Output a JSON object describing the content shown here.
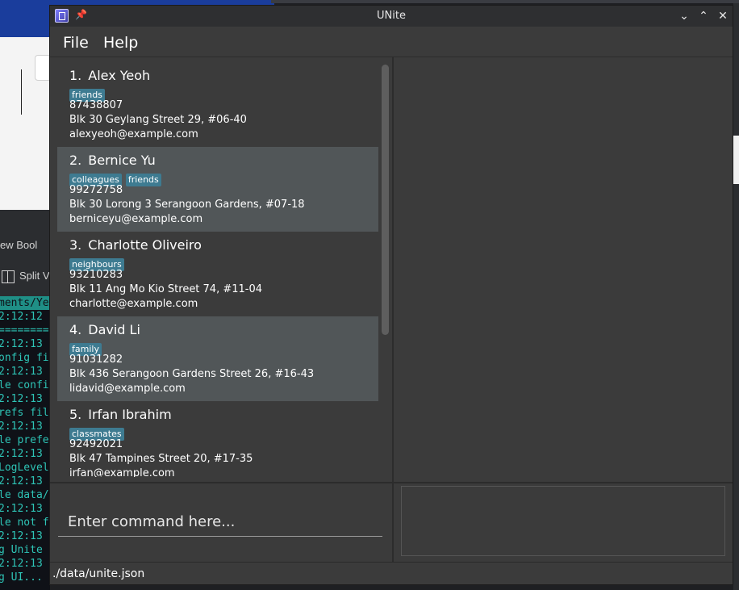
{
  "background": {
    "menu_fragment": "ew   Bool",
    "split_fragment": "Split V",
    "console_lines": [
      "ments/Ye",
      "2:12:12",
      "========",
      "2:12:13",
      "onfig fi",
      "2:12:13",
      "le confi",
      "2:12:13",
      "refs fil",
      "2:12:13",
      "le prefe",
      "2:12:13",
      "LogLevel",
      "2:12:13",
      "le data/",
      "2:12:13",
      "le not f",
      "2:12:13",
      "g Unite",
      "2:12:13",
      "g UI..."
    ]
  },
  "window": {
    "title": "UNite",
    "controls": {
      "minimize": "⌄",
      "maximize": "⌃",
      "close": "✕"
    }
  },
  "menu": {
    "file": "File",
    "help": "Help"
  },
  "persons": [
    {
      "index": "1.",
      "name": "Alex Yeoh",
      "tags": [
        "friends"
      ],
      "phone": "87438807",
      "address": "Blk 30 Geylang Street 29, #06-40",
      "email": "alexyeoh@example.com"
    },
    {
      "index": "2.",
      "name": "Bernice Yu",
      "tags": [
        "colleagues",
        "friends"
      ],
      "phone": "99272758",
      "address": "Blk 30 Lorong 3 Serangoon Gardens, #07-18",
      "email": "berniceyu@example.com"
    },
    {
      "index": "3.",
      "name": "Charlotte Oliveiro",
      "tags": [
        "neighbours"
      ],
      "phone": "93210283",
      "address": "Blk 11 Ang Mo Kio Street 74, #11-04",
      "email": "charlotte@example.com"
    },
    {
      "index": "4.",
      "name": "David Li",
      "tags": [
        "family"
      ],
      "phone": "91031282",
      "address": "Blk 436 Serangoon Gardens Street 26, #16-43",
      "email": "lidavid@example.com"
    },
    {
      "index": "5.",
      "name": "Irfan Ibrahim",
      "tags": [
        "classmates"
      ],
      "phone": "92492021",
      "address": "Blk 47 Tampines Street 20, #17-35",
      "email": "irfan@example.com"
    }
  ],
  "command": {
    "placeholder": "Enter command here...",
    "value": ""
  },
  "result": {
    "text": ""
  },
  "status": {
    "path": "./data/unite.json"
  }
}
